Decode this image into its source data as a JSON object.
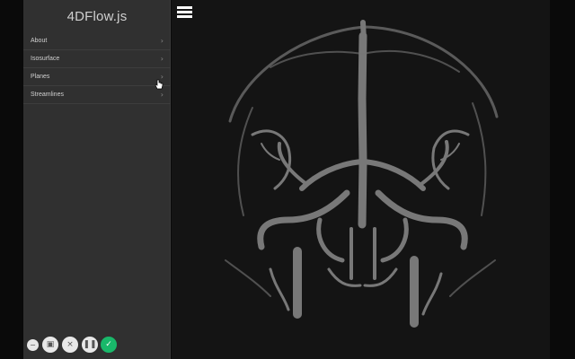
{
  "app": {
    "title": "4DFlow.js"
  },
  "menu": {
    "items": [
      {
        "label": "About"
      },
      {
        "label": "Isosurface"
      },
      {
        "label": "Planes"
      },
      {
        "label": "Streamlines"
      }
    ],
    "chevron": "›"
  },
  "icons": {
    "menu": "hamburger-icon",
    "chevron": "chevron-right-icon",
    "cursor": "hand-pointer-icon"
  },
  "recorder": {
    "minimize": "−",
    "camera": "▣",
    "close": "×",
    "pause": "❚❚",
    "confirm": "✓"
  },
  "colors": {
    "sidebar": "#303030",
    "viewport": "#141414",
    "vessel": "#9a9a9a",
    "confirm": "#19b86a"
  }
}
